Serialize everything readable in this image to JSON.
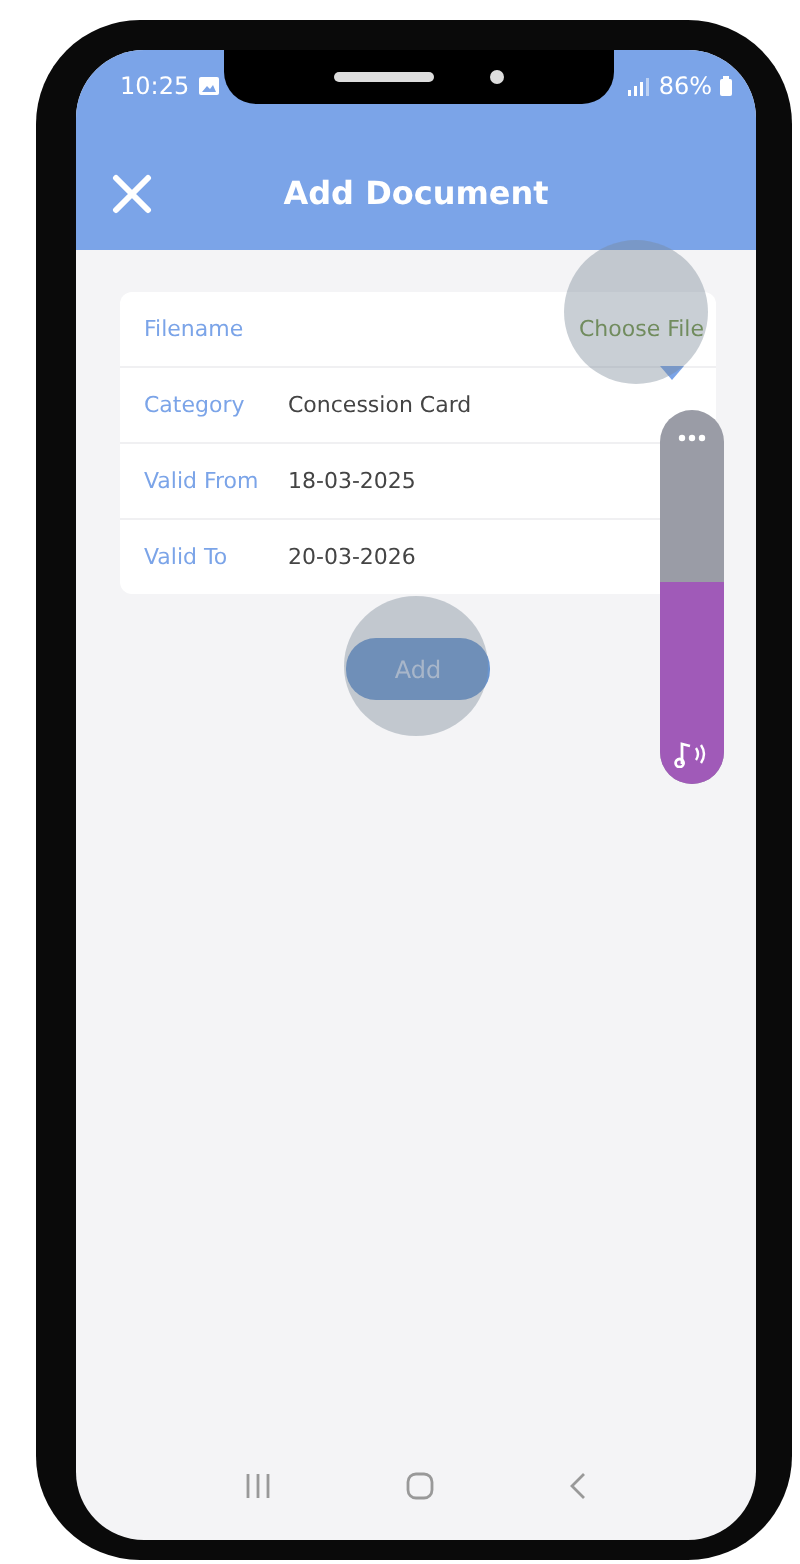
{
  "status_bar": {
    "time": "10:25",
    "battery": "86%"
  },
  "header": {
    "title": "Add Document"
  },
  "form": {
    "rows": [
      {
        "kind": "file",
        "label": "Filename",
        "action": "Choose File"
      },
      {
        "kind": "select",
        "label": "Category",
        "value": "Concession Card"
      },
      {
        "kind": "text",
        "label": "Valid From",
        "value": "18-03-2025"
      },
      {
        "kind": "text",
        "label": "Valid To",
        "value": "20-03-2026"
      }
    ]
  },
  "add_button": {
    "label": "Add"
  },
  "volume_panel": {
    "level": 0.54
  }
}
